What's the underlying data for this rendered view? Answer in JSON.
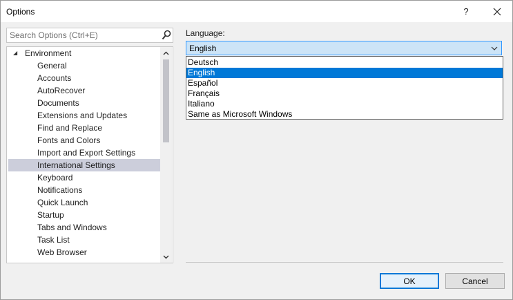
{
  "window": {
    "title": "Options",
    "help_label": "?",
    "close_label": "✕"
  },
  "search": {
    "placeholder": "Search Options (Ctrl+E)",
    "icon": "search-icon"
  },
  "tree": {
    "parent": {
      "label": "Environment",
      "expanded": true
    },
    "items": [
      "General",
      "Accounts",
      "AutoRecover",
      "Documents",
      "Extensions and Updates",
      "Find and Replace",
      "Fonts and Colors",
      "Import and Export Settings",
      "International Settings",
      "Keyboard",
      "Notifications",
      "Quick Launch",
      "Startup",
      "Tabs and Windows",
      "Task List",
      "Web Browser"
    ],
    "selected": "International Settings"
  },
  "language": {
    "label": "Language:",
    "selected": "English",
    "options": [
      "Deutsch",
      "English",
      "Español",
      "Français",
      "Italiano",
      "Same as Microsoft Windows"
    ]
  },
  "buttons": {
    "ok": "OK",
    "cancel": "Cancel"
  },
  "colors": {
    "accent": "#0078d7",
    "selection": "#cccedb",
    "combo_bg": "#cce4f7"
  }
}
